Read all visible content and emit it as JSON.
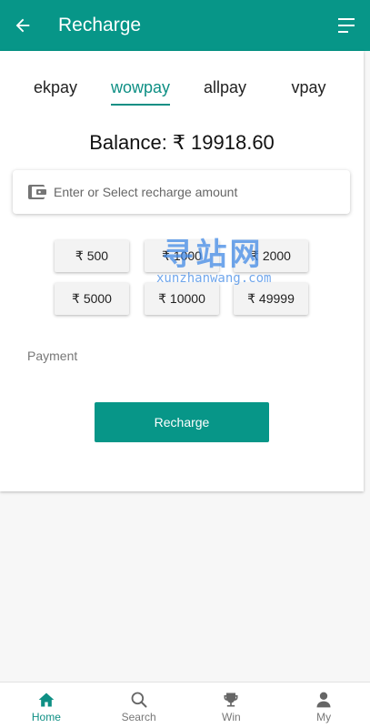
{
  "header": {
    "title": "Recharge",
    "back_icon": "arrow-left-icon",
    "menu_icon": "menu-lines-icon"
  },
  "tabs": [
    {
      "label": "ekpay",
      "active": false
    },
    {
      "label": "wowpay",
      "active": true
    },
    {
      "label": "allpay",
      "active": false
    },
    {
      "label": "vpay",
      "active": false
    }
  ],
  "balance": "Balance: ₹ 19918.60",
  "amount_input": {
    "placeholder": "Enter or Select recharge amount",
    "value": "",
    "icon": "wallet-icon"
  },
  "amount_options": [
    "₹ 500",
    "₹ 1000",
    "₹ 2000",
    "₹ 5000",
    "₹ 10000",
    "₹ 49999"
  ],
  "watermark": {
    "big": "寻站网",
    "small": "xunzhanwang.com"
  },
  "payment_label": "Payment",
  "recharge_button": "Recharge",
  "bottom_nav": [
    {
      "label": "Home",
      "icon": "home-icon",
      "active": true
    },
    {
      "label": "Search",
      "icon": "search-icon",
      "active": false
    },
    {
      "label": "Win",
      "icon": "trophy-icon",
      "active": false
    },
    {
      "label": "My",
      "icon": "person-icon",
      "active": false
    }
  ],
  "colors": {
    "accent": "#079688",
    "accent_text": "#0e8f84",
    "background": "#f7f7f7"
  }
}
